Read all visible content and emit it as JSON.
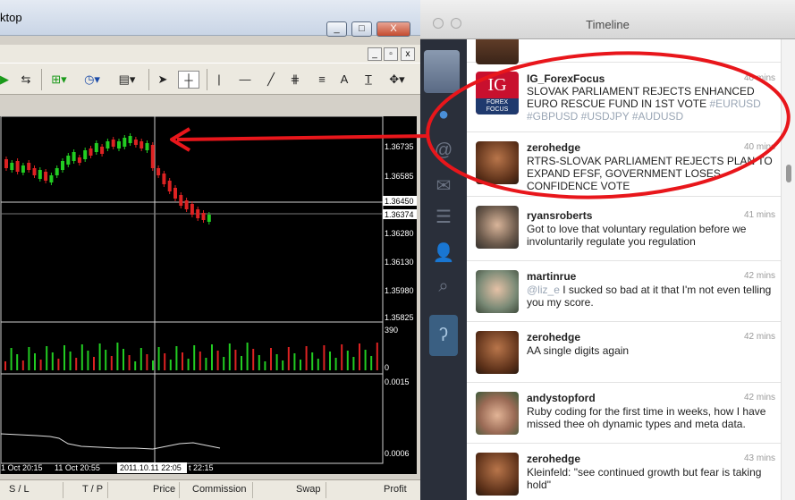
{
  "mt4": {
    "title": "ktop",
    "win_buttons": [
      "_",
      "□",
      "X"
    ],
    "mdi_buttons": [
      "_",
      "▫",
      "x"
    ],
    "toolbar": {
      "icons": [
        "play-icon",
        "crosshair-icon",
        "new-order-icon",
        "clock-icon",
        "template-icon",
        "cursor-icon",
        "crosshair-cursor-icon",
        "vertical-line-icon",
        "horizontal-line-icon",
        "trend-line-icon",
        "fibonacci-icon",
        "text-icon",
        "label-icon",
        "arrows-icon"
      ],
      "text_label": "A"
    },
    "chart": {
      "price_labels": [
        "1.36735",
        "1.36585",
        "1.36450",
        "1.36374",
        "1.36280",
        "1.36130",
        "1.35980",
        "1.35825"
      ],
      "volume_labels": [
        "390",
        "0"
      ],
      "indicator_labels": [
        "0.0015",
        "0.0006"
      ],
      "time_labels": [
        "1 Oct 20:15",
        "11 Oct 20:55",
        "2011.10.11 22:05",
        "t 22:15"
      ],
      "colors": {
        "bull": "#22cc22",
        "bear": "#dd2222",
        "grid": "#cfcfcf",
        "bg": "#000000"
      }
    },
    "statusbar": {
      "columns": [
        "S / L",
        "T / P",
        "Price",
        "Commission",
        "Swap",
        "Profit"
      ]
    }
  },
  "twitter": {
    "title": "Timeline",
    "sidebar_icons": [
      "user-avatar",
      "timeline-icon",
      "mentions-icon",
      "messages-icon",
      "lists-icon",
      "profile-icon",
      "search-icon",
      "ear-icon"
    ],
    "tweets": [
      {
        "user": "IG_ForexFocus",
        "time": "40 mins",
        "text": "SLOVAK PARLIAMENT REJECTS ENHANCED EURO RESCUE FUND IN 1ST VOTE",
        "hashtags": "#EURUSD #GBPUSD #USDJPY #AUDUSD",
        "avatar_lines": [
          "IG",
          "FOREX",
          "FOCUS"
        ]
      },
      {
        "user": "zerohedge",
        "time": "40 mins",
        "text": "RTRS-SLOVAK PARLIAMENT REJECTS PLAN TO EXPAND EFSF, GOVERNMENT LOSES CONFIDENCE VOTE"
      },
      {
        "user": "ryansroberts",
        "time": "41 mins",
        "text": "Got to love that voluntary regulation before we involuntarily regulate you regulation"
      },
      {
        "user": "martinrue",
        "time": "42 mins",
        "mention": "@liz_e",
        "text": " I sucked so bad at it that I'm not even telling you my score."
      },
      {
        "user": "zerohedge",
        "time": "42 mins",
        "text": "AA single digits again"
      },
      {
        "user": "andystopford",
        "time": "42 mins",
        "text": "Ruby coding for the first time in weeks, how I have missed thee oh dynamic types and meta data."
      },
      {
        "user": "zerohedge",
        "time": "43 mins",
        "text": "Kleinfeld: \"see continued growth but fear is taking hold\""
      }
    ]
  },
  "annotation": {
    "color": "#e8161b"
  }
}
